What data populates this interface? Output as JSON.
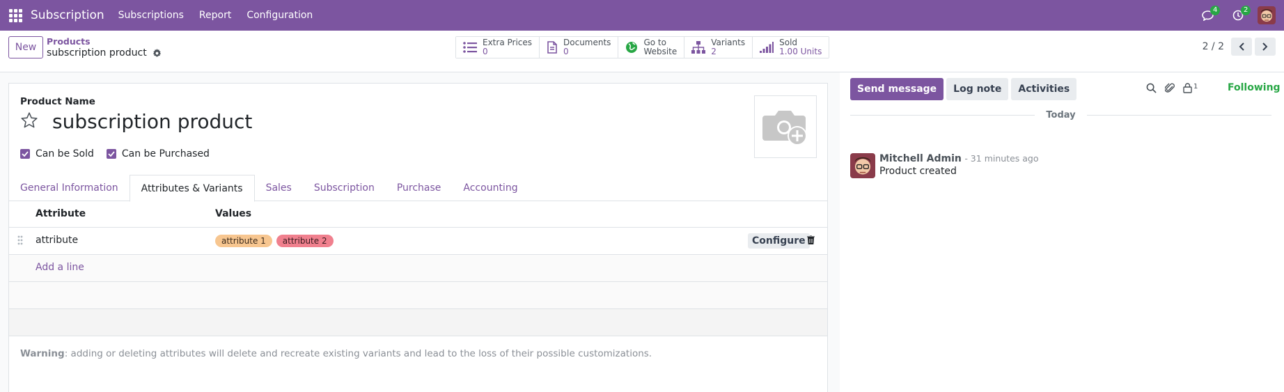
{
  "navbar": {
    "app_title": "Subscription",
    "menu": [
      "Subscriptions",
      "Report",
      "Configuration"
    ],
    "messages_badge": "4",
    "activities_badge": "2"
  },
  "control_panel": {
    "new_label": "New",
    "breadcrumb_parent": "Products",
    "breadcrumb_current": "subscription product",
    "smart_buttons": [
      {
        "label": "Extra Prices",
        "value": "0",
        "icon": "list-icon"
      },
      {
        "label": "Documents",
        "value": "0",
        "icon": "document-icon"
      },
      {
        "label": "Go to",
        "value": "Website",
        "icon": "globe-icon"
      },
      {
        "label": "Variants",
        "value": "2",
        "icon": "sitemap-icon"
      },
      {
        "label": "Sold",
        "value": "1.00 Units",
        "icon": "signal-icon"
      }
    ],
    "pager": "2 / 2"
  },
  "form": {
    "product_name_label": "Product Name",
    "product_name": "subscription product",
    "can_be_sold_label": "Can be Sold",
    "can_be_purchased_label": "Can be Purchased",
    "tabs": [
      "General Information",
      "Attributes & Variants",
      "Sales",
      "Subscription",
      "Purchase",
      "Accounting"
    ],
    "active_tab": "Attributes & Variants",
    "table": {
      "col_attribute": "Attribute",
      "col_values": "Values",
      "rows": [
        {
          "attribute": "attribute",
          "values": [
            "attribute 1",
            "attribute 2"
          ],
          "configure_label": "Configure"
        }
      ],
      "add_line": "Add a line"
    },
    "warning_bold": "Warning",
    "warning_text": ": adding or deleting attributes will delete and recreate existing variants and lead to the loss of their possible customizations."
  },
  "chatter": {
    "send_message": "Send message",
    "log_note": "Log note",
    "activities": "Activities",
    "follower_count": "1",
    "following": "Following",
    "date_separator": "Today",
    "messages": [
      {
        "author": "Mitchell Admin",
        "time": "- 31 minutes ago",
        "body": "Product created"
      }
    ]
  },
  "colors": {
    "brand": "#7c55a0",
    "success": "#28a745",
    "tag_1": "#f7c690",
    "tag_2": "#f0808e"
  }
}
